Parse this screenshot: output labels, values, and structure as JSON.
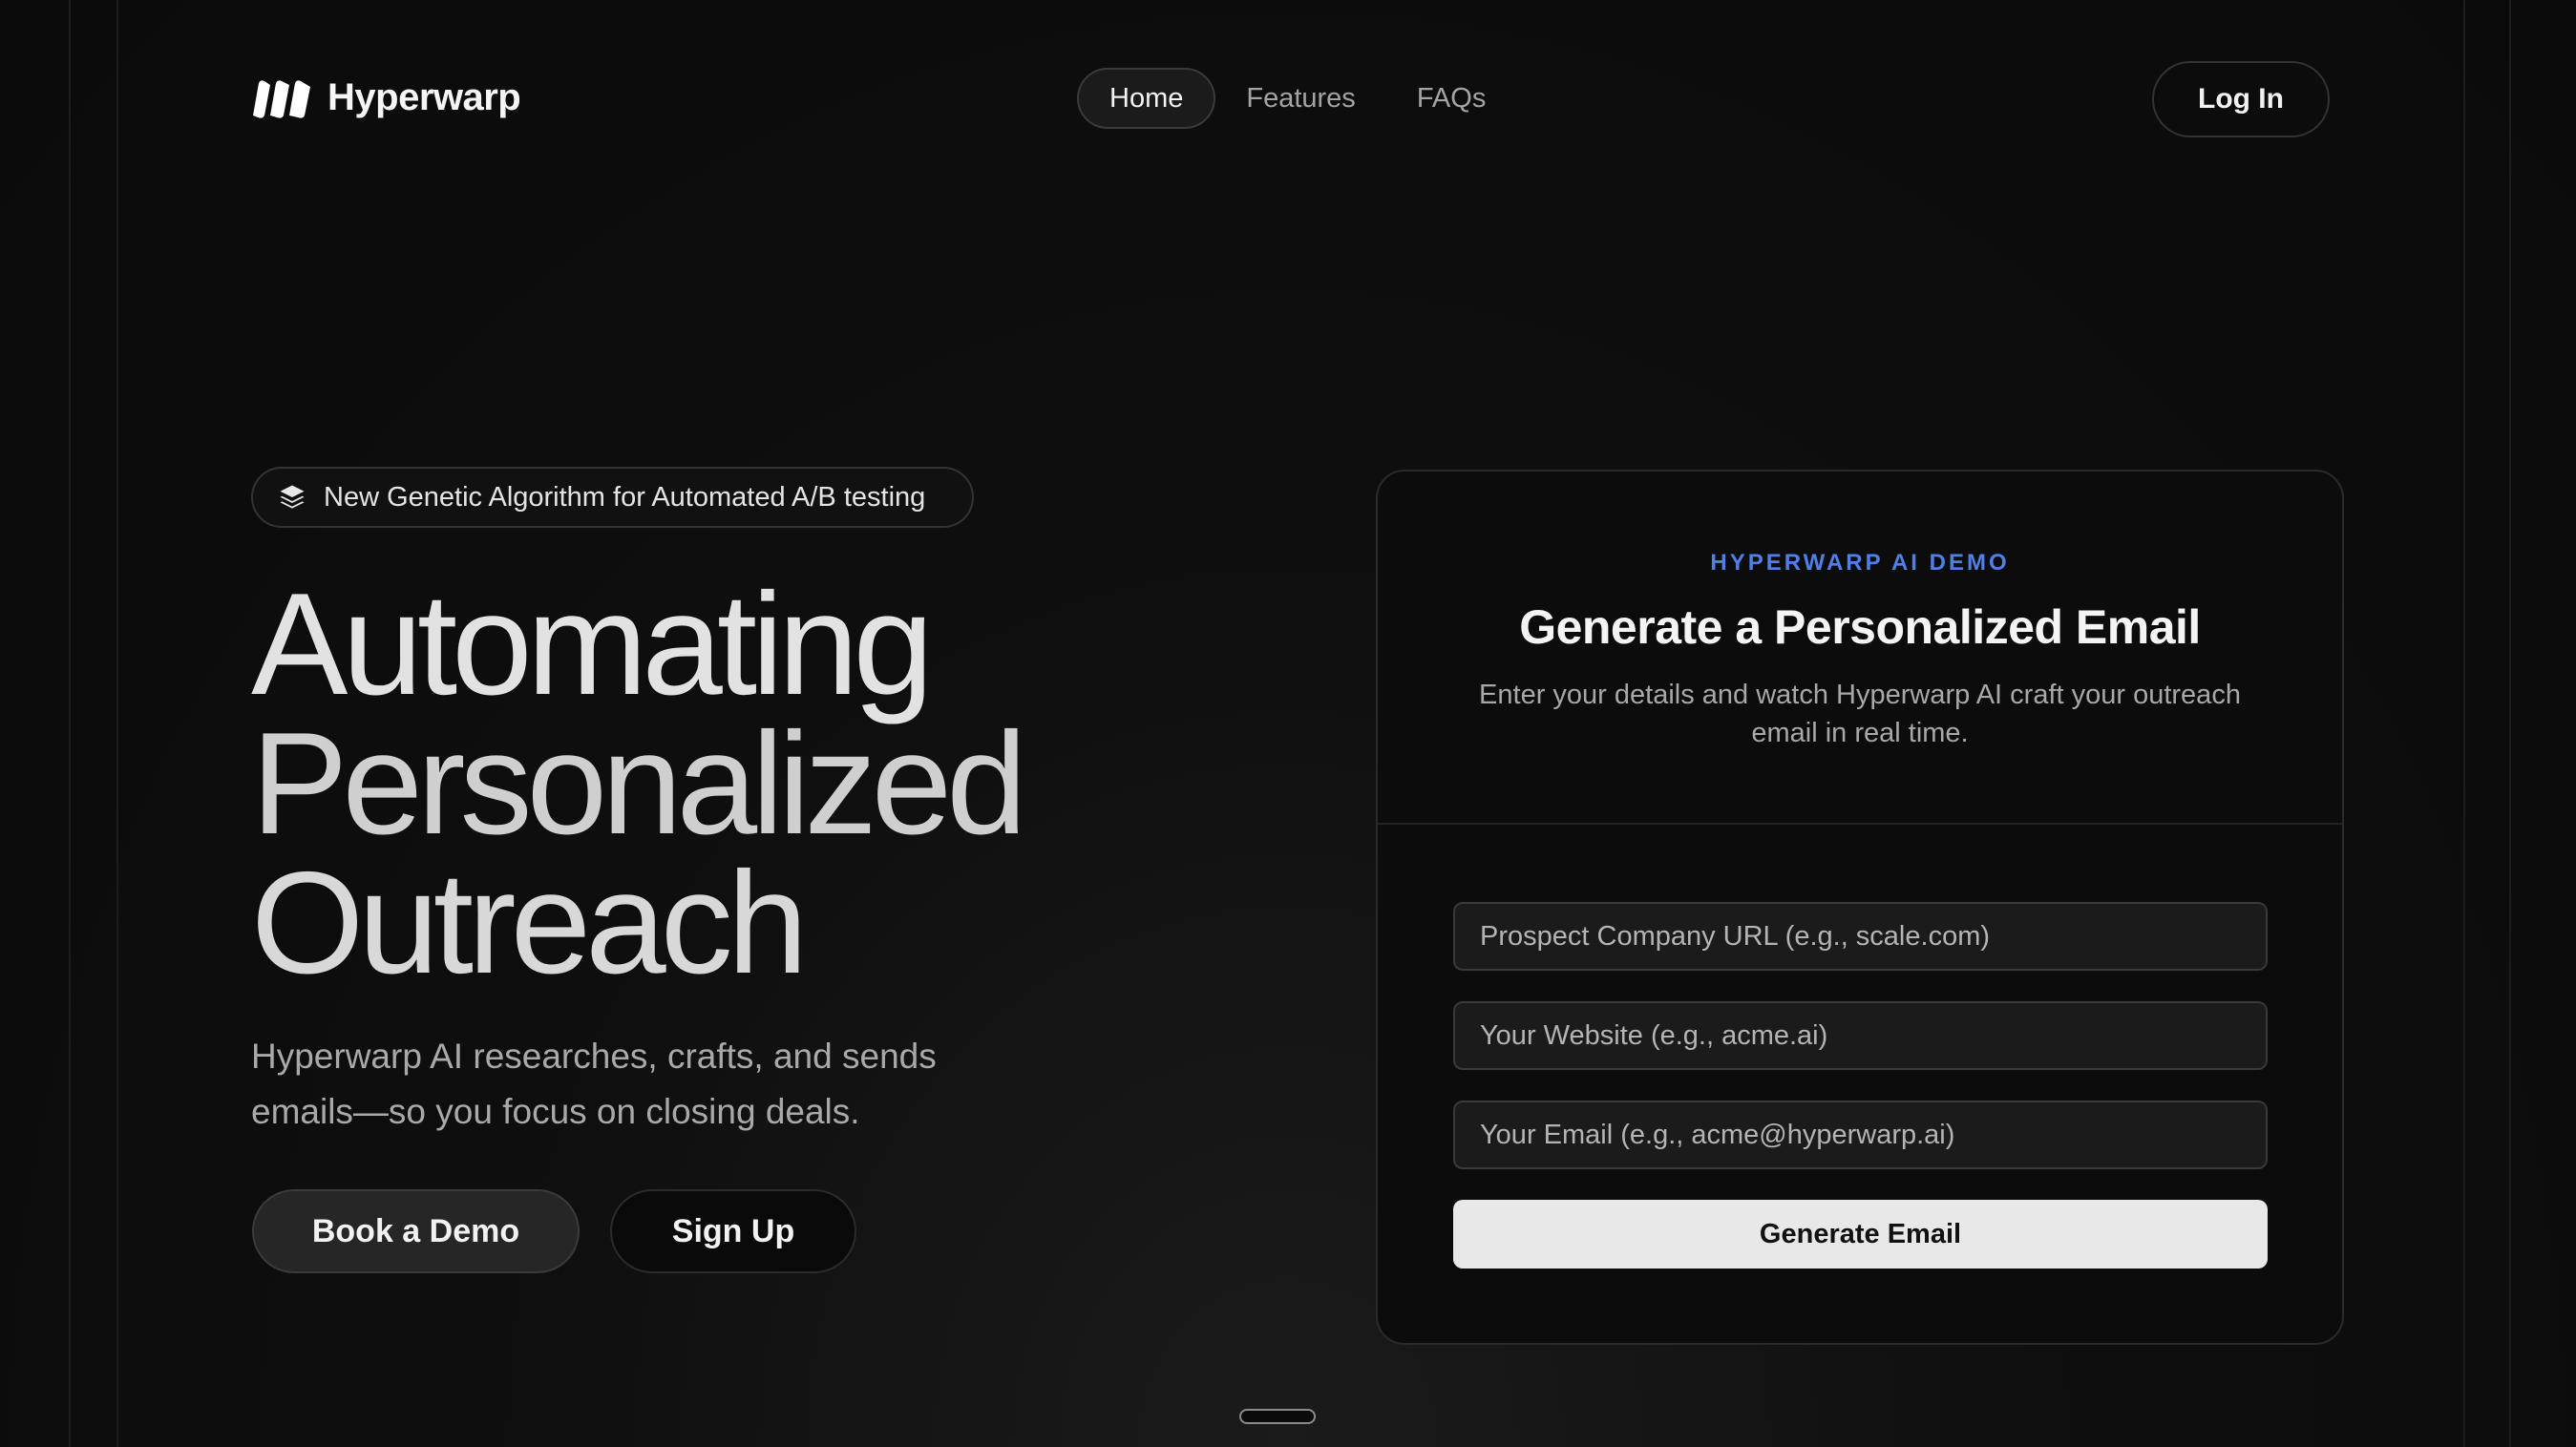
{
  "brand": {
    "name": "Hyperwarp",
    "logo_icon": "hyperwarp-logo-icon"
  },
  "nav": {
    "items": [
      {
        "label": "Home",
        "active": true
      },
      {
        "label": "Features",
        "active": false
      },
      {
        "label": "FAQs",
        "active": false
      }
    ],
    "login_label": "Log In"
  },
  "hero": {
    "badge": {
      "icon": "layers-icon",
      "text": "New Genetic Algorithm for Automated A/B testing"
    },
    "title_lines": [
      "Automating",
      "Personalized",
      "Outreach"
    ],
    "subtitle": "Hyperwarp AI researches, crafts, and sends emails—so you focus on closing deals.",
    "primary_cta": "Book a Demo",
    "secondary_cta": "Sign Up"
  },
  "demo": {
    "eyebrow": "HYPERWARP AI DEMO",
    "title": "Generate a Personalized Email",
    "description": "Enter your details and watch Hyperwarp AI craft your outreach email in real time.",
    "fields": [
      {
        "value": "",
        "placeholder": "Prospect Company URL (e.g., scale.com)"
      },
      {
        "value": "",
        "placeholder": "Your Website (e.g., acme.ai)"
      },
      {
        "value": "",
        "placeholder": "Your Email (e.g., acme@hyperwarp.ai)"
      }
    ],
    "submit_label": "Generate Email"
  },
  "colors": {
    "background": "#0b0b0b",
    "accent": "#4f7fe8",
    "button_light": "#e8e8e8"
  }
}
